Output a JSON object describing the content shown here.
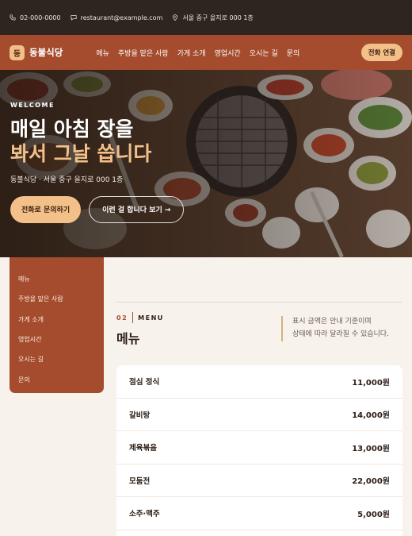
{
  "topbar": {
    "phone": "02-000-0000",
    "email": "restaurant@example.com",
    "address": "서울 중구 을지로 000 1층"
  },
  "nav": {
    "brand_mark": "동",
    "brand_name": "동불식당",
    "items": [
      "메뉴",
      "주방을 맡은 사람",
      "가게 소개",
      "영업시간",
      "오시는 길",
      "문의"
    ],
    "cta": "전화 연결"
  },
  "hero": {
    "eyebrow": "WELCOME",
    "title_line1": "매일 아침 장을",
    "title_line2": "봐서 그날 씁니다",
    "subtitle": "동불식당 · 서울 중구 을지로 000 1층",
    "primary_button": "전화로 문의하기",
    "secondary_button": "이런 걸 합니다 보기 →"
  },
  "sidenav": {
    "items": [
      "메뉴",
      "주방을 맡은 사람",
      "가게 소개",
      "영업시간",
      "오시는 길",
      "문의"
    ]
  },
  "menu_section": {
    "number": "02",
    "label": "MENU",
    "title": "메뉴",
    "note_line1": "표시 금액은 안내 기준이며",
    "note_line2": "상태에 따라 달라질 수 있습니다.",
    "items": [
      {
        "name": "점심 정식",
        "price": "11,000원"
      },
      {
        "name": "갈비탕",
        "price": "14,000원"
      },
      {
        "name": "제육볶음",
        "price": "13,000원"
      },
      {
        "name": "모둠전",
        "price": "22,000원"
      },
      {
        "name": "소주·맥주",
        "price": "5,000원"
      }
    ]
  }
}
